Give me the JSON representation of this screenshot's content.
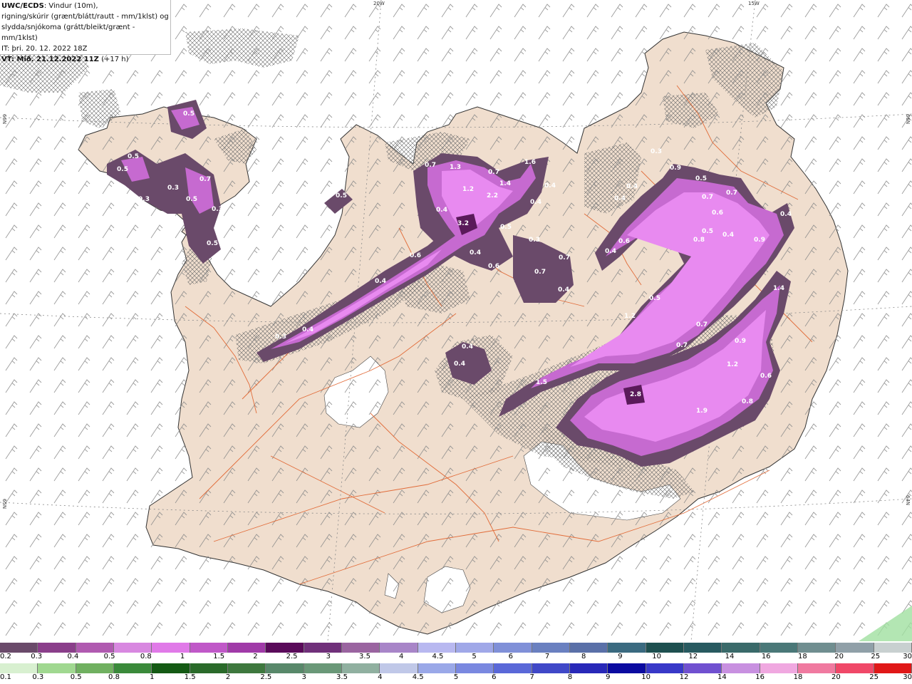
{
  "info": {
    "model": "UWC/ECDS",
    "line1_rest": ": Vindur (10m),",
    "line2": "rigning/skúrir (grænt/blátt/rautt - mm/1klst) og",
    "line3": "slydda/snjókoma (grátt/bleikt/grænt - mm/1klst)",
    "line4": "IT: þri. 20. 12. 2022 18Z",
    "vt_label": "VT: Mið. 21.12.2022 11Z",
    "vt_rest": " (+17 h)"
  },
  "grid_labels": {
    "lon_20w": "20W",
    "lon_15w": "15W",
    "lat_left_top": "66N",
    "lat_left_bottom": "65N",
    "lat_right_top": "66N",
    "lat_right_bottom": "64N"
  },
  "precip_values": [
    "0.5",
    "0.5",
    "0.5",
    "0.3",
    "0.3",
    "0.7",
    "0.5",
    "0.3",
    "0.5",
    "0.5",
    "0.7",
    "1.3",
    "0.7",
    "1.6",
    "1.4",
    "2.2",
    "1.2",
    "0.4",
    "0.4",
    "0.4",
    "3.2",
    "0.6",
    "0.4",
    "0.5",
    "0.6",
    "0.4",
    "0.4",
    "0.3",
    "0.3",
    "0.7",
    "0.7",
    "0.4",
    "0.3",
    "0.9",
    "0.5",
    "0.7",
    "0.7",
    "0.6",
    "0.4",
    "0.4",
    "0.6",
    "0.5",
    "0.4",
    "0.4",
    "0.8",
    "0.9",
    "0.4",
    "1.4",
    "0.5",
    "1.2",
    "0.7",
    "0.7",
    "0.9",
    "0.4",
    "0.4",
    "1.5",
    "2.8",
    "1.2",
    "1.9",
    "0.8",
    "0.6"
  ],
  "legend_top": {
    "colors": [
      "#6a4a6a",
      "#8a3e8a",
      "#b05ab0",
      "#d888e0",
      "#e07ae8",
      "#c058c8",
      "#a03aa8",
      "#5a0a5a",
      "#70307a",
      "#9a64a0",
      "#a885c8",
      "#b8b8f0",
      "#a0a8e8",
      "#8090d8",
      "#6a80c0",
      "#5a70a8",
      "#3a6a80",
      "#1e5050",
      "#285a60",
      "#3a6a6a",
      "#4a7878",
      "#708e90",
      "#90a0a8",
      "#c8d0d0"
    ],
    "labels": [
      "0.2",
      "0.3",
      "0.4",
      "0.5",
      "0.8",
      "1",
      "1.5",
      "2",
      "2.5",
      "3",
      "3.5",
      "4",
      "4.5",
      "5",
      "6",
      "7",
      "8",
      "9",
      "10",
      "12",
      "14",
      "16",
      "18",
      "20",
      "25",
      "30"
    ]
  },
  "legend_bottom": {
    "colors": [
      "#d8f0d0",
      "#a0d890",
      "#70b060",
      "#3a8a3a",
      "#145a14",
      "#2a6a2a",
      "#3e783e",
      "#58886a",
      "#6a9878",
      "#90b0a0",
      "#c0c8e8",
      "#9aa8e8",
      "#7a88e0",
      "#5a68d8",
      "#4048c8",
      "#2828b8",
      "#0a0aa0",
      "#3838c8",
      "#7050d0",
      "#c890e0",
      "#f0a8e0",
      "#f07aa0",
      "#f04868",
      "#e01818"
    ],
    "labels": [
      "0.1",
      "0.3",
      "0.5",
      "0.8",
      "1",
      "1.5",
      "2",
      "2.5",
      "3",
      "3.5",
      "4",
      "4.5",
      "5",
      "6",
      "7",
      "8",
      "9",
      "10",
      "12",
      "14",
      "16",
      "18",
      "20",
      "25",
      "30"
    ]
  }
}
